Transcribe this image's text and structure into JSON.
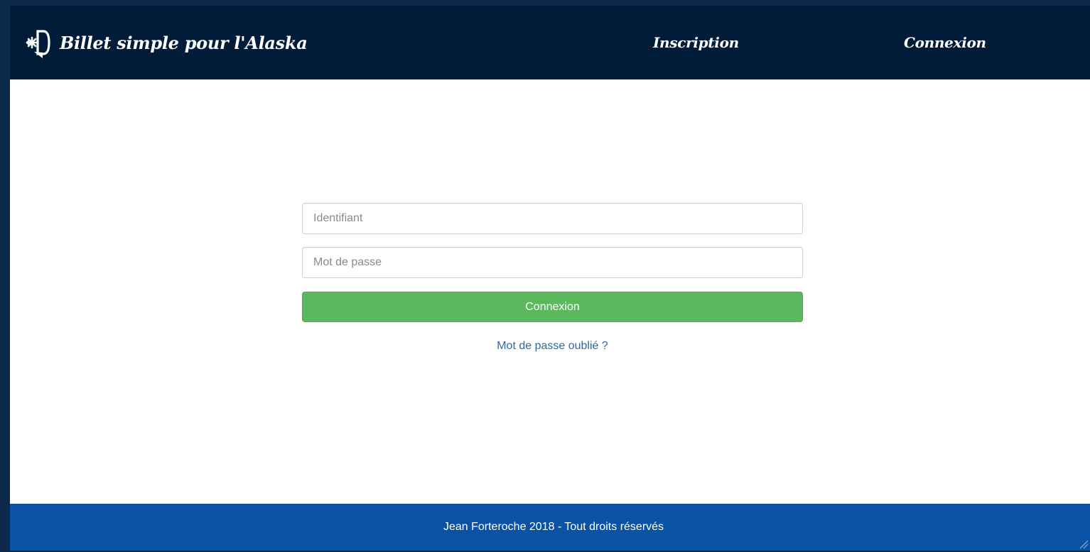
{
  "header": {
    "brand_title": "Billet simple pour l'Alaska",
    "brand_icon": "snowflake-document-icon",
    "nav": [
      {
        "label": "Inscription"
      },
      {
        "label": "Connexion"
      }
    ]
  },
  "login": {
    "username_placeholder": "Identifiant",
    "username_value": "",
    "password_placeholder": "Mot de passe",
    "password_value": "",
    "submit_label": "Connexion",
    "forgot_label": "Mot de passe oublié ?"
  },
  "footer": {
    "text": "Jean Forteroche 2018 - Tout droits réservés"
  },
  "colors": {
    "navbar_bg": "#001c38",
    "footer_bg": "#0a52a3",
    "submit_bg": "#5cb85c",
    "link": "#2a6aa5"
  }
}
